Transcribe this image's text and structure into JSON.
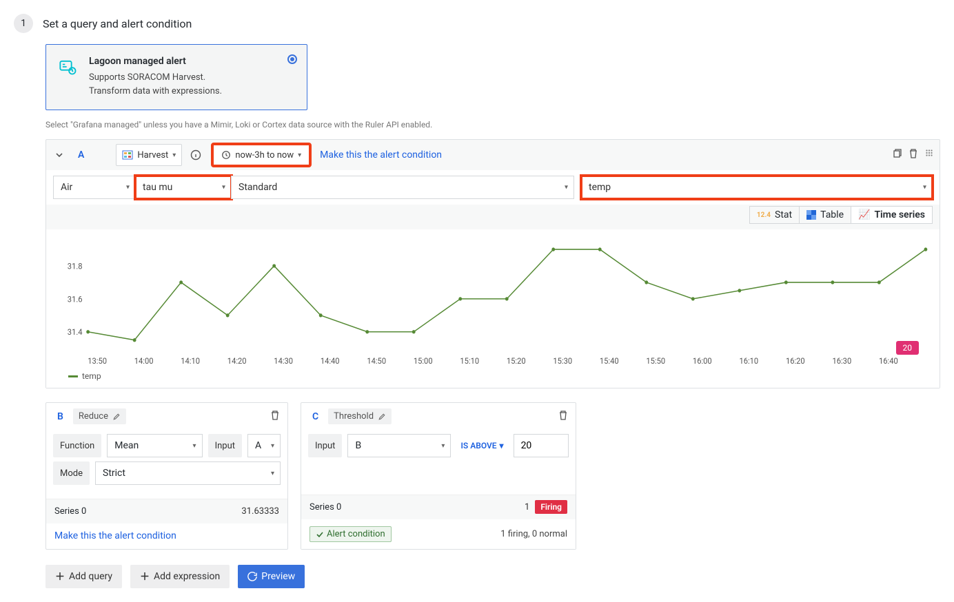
{
  "step": {
    "num": "1",
    "title": "Set a query and alert condition"
  },
  "alert_card": {
    "title": "Lagoon managed alert",
    "desc1": "Supports SORACOM Harvest.",
    "desc2": "Transform data with expressions."
  },
  "helper_text": "Select \"Grafana managed\" unless you have a Mimir, Loki or Cortex data source with the Ruler API enabled.",
  "query_a": {
    "letter": "A",
    "datasource": "Harvest",
    "time_range": "now-3h to now",
    "make_cond": "Make this the alert condition",
    "f_air": "Air",
    "f_tau": "tau mu",
    "f_std": "Standard",
    "f_temp": "temp"
  },
  "viz": {
    "stat": "Stat",
    "table": "Table",
    "ts": "Time series"
  },
  "chart_data": {
    "type": "line",
    "series": [
      {
        "name": "temp",
        "values": [
          31.4,
          31.35,
          31.7,
          31.5,
          31.8,
          31.5,
          31.4,
          31.4,
          31.6,
          31.6,
          31.9,
          31.9,
          31.7,
          31.6,
          31.65,
          31.7,
          31.7,
          31.7,
          31.9
        ]
      }
    ],
    "x_labels": [
      "13:50",
      "14:00",
      "14:10",
      "14:20",
      "14:30",
      "14:40",
      "14:50",
      "15:00",
      "15:10",
      "15:20",
      "15:30",
      "15:40",
      "15:50",
      "16:00",
      "16:10",
      "16:20",
      "16:30",
      "16:40"
    ],
    "ylim": [
      31.3,
      31.95
    ],
    "y_ticks": [
      31.4,
      31.6,
      31.8
    ],
    "legend": "temp",
    "annotation_badge": "20"
  },
  "reduce": {
    "letter": "B",
    "tag": "Reduce",
    "fn_label": "Function",
    "fn_value": "Mean",
    "inp_label": "Input",
    "inp_value": "A",
    "mode_label": "Mode",
    "mode_value": "Strict",
    "series": "Series 0",
    "series_val": "31.63333",
    "link": "Make this the alert condition"
  },
  "thresh": {
    "letter": "C",
    "tag": "Threshold",
    "inp_label": "Input",
    "inp_value": "B",
    "op": "IS ABOVE",
    "op_val": "20",
    "series": "Series 0",
    "series_val": "1",
    "firing": "Firing",
    "chip": "Alert condition",
    "summary": "1 firing, 0 normal"
  },
  "actions": {
    "add_query": "Add query",
    "add_expr": "Add expression",
    "preview": "Preview"
  }
}
